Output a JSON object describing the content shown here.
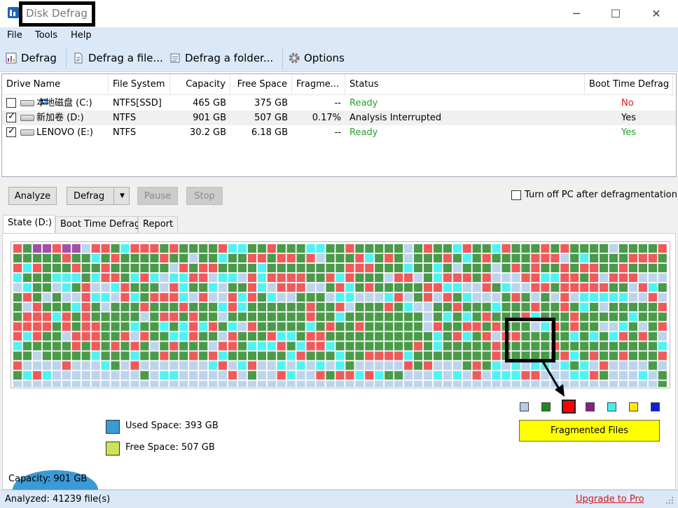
{
  "window": {
    "title": "Disk Defrag",
    "min_glyph": "─",
    "max_glyph": "☐",
    "close_glyph": "✕"
  },
  "menu": {
    "file": "File",
    "tools": "Tools",
    "help": "Help"
  },
  "toolbar": {
    "defrag": "Defrag",
    "defrag_file": "Defrag a file...",
    "defrag_folder": "Defrag a folder...",
    "options": "Options"
  },
  "columns": {
    "drive_name": "Drive Name",
    "file_system": "File System",
    "capacity": "Capacity",
    "free_space": "Free Space",
    "fragmented": "Fragme...",
    "status": "Status",
    "boot_time_defrag": "Boot Time Defrag"
  },
  "drives": [
    {
      "name": "本地磁盘 (C:)",
      "fs": "NTFS[SSD]",
      "capacity": "465 GB",
      "free": "375 GB",
      "frag": "--",
      "status": "Ready",
      "boot": "No",
      "checked": false
    },
    {
      "name": "新加卷 (D:)",
      "fs": "NTFS",
      "capacity": "901 GB",
      "free": "507 GB",
      "frag": "0.17%",
      "status": "Analysis Interrupted",
      "boot": "Yes",
      "checked": true
    },
    {
      "name": "LENOVO (E:)",
      "fs": "NTFS",
      "capacity": "30.2 GB",
      "free": "6.18 GB",
      "frag": "--",
      "status": "Ready",
      "boot": "Yes",
      "checked": true
    }
  ],
  "actions": {
    "analyze": "Analyze",
    "defrag": "Defrag",
    "split_arrow": "▼",
    "pause": "Pause",
    "stop": "Stop",
    "turn_off": "Turn off PC after defragmentation"
  },
  "tabs": {
    "state": "State (D:)",
    "boot": "Boot Time Defrag",
    "report": "Report"
  },
  "legend": {
    "used": "Used Space: 393 GB",
    "free": "Free Space: 507 GB",
    "capacity": "Capacity: 901 GB",
    "selected": "Fragmented Files"
  },
  "colors": {
    "used": "#3a9ad6",
    "free": "#c9e35a",
    "cluster_free": "#bcd4ec",
    "cluster_used": "#4a9a4a",
    "cluster_frag": "#f05a5a",
    "cluster_system": "#a050a8",
    "cluster_mft": "#4ff3f3",
    "legend_squares": [
      "#b4cde4",
      "#1e8a1e",
      "#ff0000",
      "#8a1e8a",
      "#3ff0f0",
      "#ffe800",
      "#0a22e0"
    ],
    "status_ready": "#2aa02a",
    "status_no": "#e01818"
  },
  "status": {
    "analyzed": "Analyzed: 41239 file(s)",
    "upgrade": "Upgrade to Pro"
  }
}
